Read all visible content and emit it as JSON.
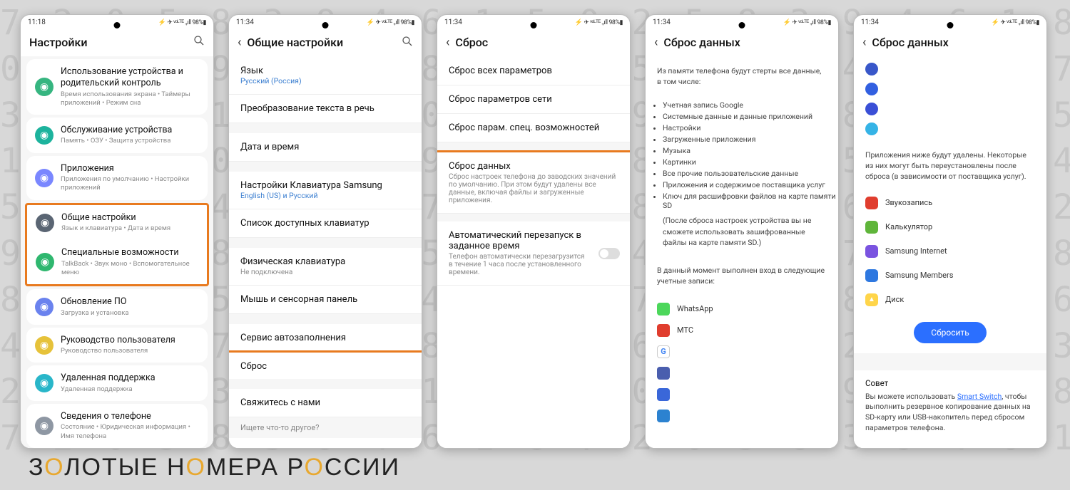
{
  "bg_numbers": "7 2 0 5 8 3 9 4 6 1 5 0 2 5 8 3 9 4 6 1 8 7 2 0 5 8 3 9 4 6 1 8 7 2\n0 5 8 3 9 4 6 1 8 7 2 0 5 8 3 9 4 6 1 8 7 2 0 5 8 3 9 4 6 1 8 7 2 5\n3 9 4 6 1 8 7 2 0 5 8 3 9 4 6 1 8 7 2 0 5 8 3 9 4 6 1 8 7 2 0 5 8 3\n1 8 7 2 0 5 8 3 9 4 6 1 8 7 2 0 5 8 3 9 4 6 1 8 7 2 0 5 8 3 9 4 6 1\n5 8 3 9 4 6 1 8 7 2 0 5 8 3 9 4 6 1 8 7 2 0 5 8 3 9 4 6 1 8 7 2 0 5\n9 4 6 1 8 7 2 0 5 8 3 9 4 6 1 8 7 2 0 5 8 3 9 4 6 1 8 7 2 0 5 8 3 9\n8 7 2 0 5 8 3 9 4 6 1 8 7 2 0 5 8 3 9 4 6 1 8 7 2 0 5 8 3 9 4 6 1 8\n4 6 1 8 7 2 0 5 8 3 9 4 6 1 8 7 2 0 5 8 3 9 4 6 1 8 7 2 0 5 8 3 9 4\n2 0 5 8 3 9 4 6 1 8 7 2 0 5 8 3 9 4 6 1 8 7 2 0 5 8 3 9 4 6 1 8 7 2\n7 2 0 5 8 3 9 4 6 1 8 7 2 0 5 8 3 9 4 6 1 8 7 2 0 5 8 3 9 4 6 1 8 7",
  "brand": {
    "p1": "З",
    "p2": "О",
    "p3": "ЛОТЫЕ Н",
    "p4": "О",
    "p5": "МЕРА Р",
    "p6": "О",
    "p7": "ССИИ"
  },
  "status": {
    "time1": "11:18",
    "time2": "11:34",
    "right": "⚡ ✈ ᵛᵒᴸᵀᴱ ₊ıll 98%▮"
  },
  "p1": {
    "title": "Настройки",
    "items": [
      {
        "label": "Использование устройства и родительский контроль",
        "sub": "Время использования экрана • Таймеры приложений • Режим сна",
        "color": "#36b580"
      },
      {
        "label": "Обслуживание устройства",
        "sub": "Память • ОЗУ • Защита устройства",
        "color": "#1db39d"
      },
      {
        "label": "Приложения",
        "sub": "Приложения по умолчанию • Настройки приложений",
        "color": "#7a87ff"
      },
      {
        "label": "Общие настройки",
        "sub": "Язык и клавиатура • Дата и время",
        "color": "#5a6573",
        "hl": true
      },
      {
        "label": "Специальные возможности",
        "sub": "TalkBack • Звук моно • Вспомогательное меню",
        "color": "#2fb76f"
      },
      {
        "label": "Обновление ПО",
        "sub": "Загрузка и установка",
        "color": "#6a82ee"
      },
      {
        "label": "Руководство пользователя",
        "sub": "Руководство пользователя",
        "color": "#e6c23a"
      },
      {
        "label": "Удаленная поддержка",
        "sub": "Удаленная поддержка",
        "color": "#29b6c9"
      },
      {
        "label": "Сведения о телефоне",
        "sub": "Состояние • Юридическая информация • Имя телефона",
        "color": "#8e97a3"
      }
    ]
  },
  "p2": {
    "title": "Общие настройки",
    "rows": [
      {
        "label": "Язык",
        "sublink": "Русский (Россия)"
      },
      {
        "label": "Преобразование текста в речь"
      },
      {
        "gap": true
      },
      {
        "label": "Дата и время"
      },
      {
        "gap": true
      },
      {
        "label": "Настройки Клавиатура Samsung",
        "sublink": "English (US) и Русский"
      },
      {
        "label": "Список доступных клавиатур"
      },
      {
        "gap": true
      },
      {
        "label": "Физическая клавиатура",
        "sub": "Не подключена"
      },
      {
        "label": "Мышь и сенсорная панель"
      },
      {
        "gap": true
      },
      {
        "label": "Сервис автозаполнения"
      },
      {
        "label": "Сброс",
        "hl": true
      },
      {
        "gap": true
      },
      {
        "label": "Свяжитесь с нами"
      }
    ],
    "footer": "Ищете что-то другое?"
  },
  "p3": {
    "title": "Сброс",
    "rows": [
      {
        "label": "Сброс всех параметров"
      },
      {
        "label": "Сброс параметров сети"
      },
      {
        "label": "Сброс парам. спец. возможностей"
      },
      {
        "gap": true
      },
      {
        "label": "Сброс данных",
        "sub": "Сброс настроек телефона до заводских значений по умолчанию. При этом будут удалены все данные, включая файлы и загруженные приложения.",
        "hl": true
      },
      {
        "gap": true
      },
      {
        "label": "Автоматический перезапуск в заданное время",
        "sub": "Телефон автоматически перезагрузится в течение 1 часа после установленного времени.",
        "switch": true
      }
    ]
  },
  "p4": {
    "title": "Сброс данных",
    "intro": "Из памяти телефона будут стерты все данные, в том числе:",
    "bullets": [
      "Учетная запись Google",
      "Системные данные и данные приложений",
      "Настройки",
      "Загруженные приложения",
      "Музыка",
      "Картинки",
      "Все прочие пользовательские данные",
      "Приложения и содержимое поставщика услуг",
      "Ключ для расшифровки файлов на карте памяти SD"
    ],
    "note": "(После сброса настроек устройства вы не сможете использовать зашифрованные файлы на карте памяти SD.)",
    "acct_intro": "В данный момент выполнен вход в следующие учетные записи:",
    "accounts": [
      {
        "name": "WhatsApp",
        "color": "#4cd75b"
      },
      {
        "name": "МТС",
        "color": "#e03d2e"
      },
      {
        "name": "",
        "color": "#ffffff",
        "g": true
      },
      {
        "name": "",
        "color": "#4a5eae"
      },
      {
        "name": "",
        "color": "#3a67d9"
      },
      {
        "name": "",
        "color": "#2c82d0"
      }
    ]
  },
  "p5": {
    "title": "Сброс данных",
    "icons": [
      "#3857c9",
      "#325fe0",
      "#3a4fd6",
      "#35b3e6"
    ],
    "apps_intro": "Приложения ниже будут удалены. Некоторые из них могут быть переустановлены после сброса (в зависимости от поставщика услуг).",
    "apps": [
      {
        "name": "Звукозапись",
        "color": "#e03d2e"
      },
      {
        "name": "Калькулятор",
        "color": "#5fb53a"
      },
      {
        "name": "Samsung Internet",
        "color": "#7a53e0"
      },
      {
        "name": "Samsung Members",
        "color": "#2e78e0"
      },
      {
        "name": "Диск",
        "color": "#ffd54a",
        "tri": true
      }
    ],
    "button": "Сбросить",
    "tip_h": "Совет",
    "tip_link": "Smart Switch",
    "tip_pre": "Вы можете использовать ",
    "tip_post": ", чтобы выполнить резервное копирование данных на SD-карту или USB-накопитель перед сбросом параметров телефона."
  }
}
